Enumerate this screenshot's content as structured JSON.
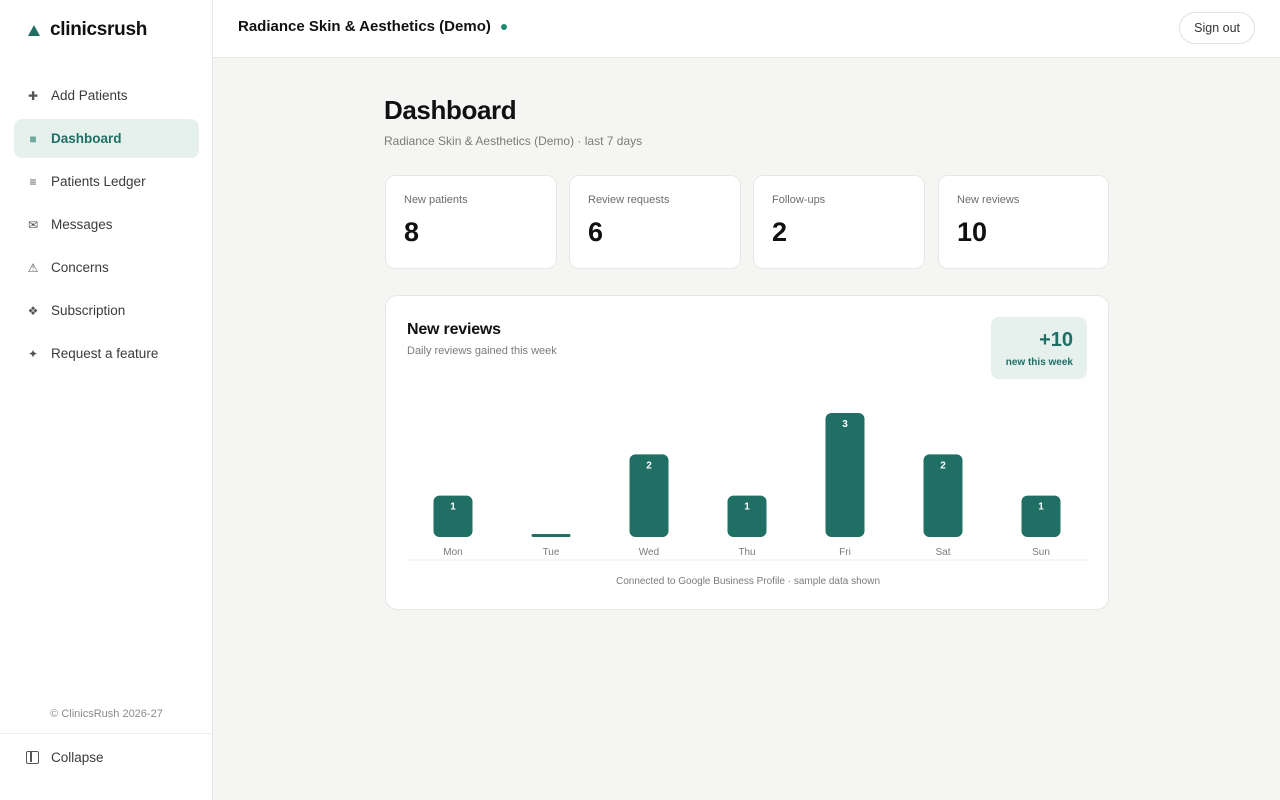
{
  "brand": {
    "name": "clinicsrush",
    "icon": "triangle-logo-icon"
  },
  "sidebar": {
    "items": [
      {
        "label": "Add Patients",
        "icon": "plus-icon",
        "glyph": "✚",
        "active": false
      },
      {
        "label": "Dashboard",
        "icon": "dashboard-square-icon",
        "glyph": "■",
        "active": true
      },
      {
        "label": "Patients Ledger",
        "icon": "list-icon",
        "glyph": "≡",
        "active": false
      },
      {
        "label": "Messages",
        "icon": "envelope-icon",
        "glyph": "✉",
        "active": false
      },
      {
        "label": "Concerns",
        "icon": "warning-icon",
        "glyph": "⚠",
        "active": false
      },
      {
        "label": "Subscription",
        "icon": "diamond-icon",
        "glyph": "❖",
        "active": false
      },
      {
        "label": "Request a feature",
        "icon": "sparkle-icon",
        "glyph": "✦",
        "active": false
      }
    ],
    "copyright": "© ClinicsRush 2026-27",
    "collapse_label": "Collapse"
  },
  "topbar": {
    "clinic_name": "Radiance Skin & Aesthetics (Demo)",
    "signout_label": "Sign out"
  },
  "page": {
    "title": "Dashboard",
    "subtitle": "Radiance Skin & Aesthetics (Demo) · last 7 days"
  },
  "stats": [
    {
      "label": "New patients",
      "value": "8"
    },
    {
      "label": "Review requests",
      "value": "6"
    },
    {
      "label": "Follow-ups",
      "value": "2"
    },
    {
      "label": "New reviews",
      "value": "10"
    }
  ],
  "reviews_card": {
    "title": "New reviews",
    "subtitle": "Daily reviews gained this week",
    "badge_value": "+10",
    "badge_label": "new this week",
    "footer": "Connected to Google Business Profile · sample data shown"
  },
  "chart_data": {
    "type": "bar",
    "categories": [
      "Mon",
      "Tue",
      "Wed",
      "Thu",
      "Fri",
      "Sat",
      "Sun"
    ],
    "values": [
      1,
      0,
      2,
      1,
      3,
      2,
      1
    ],
    "ylim": [
      0,
      3
    ],
    "grid": false,
    "color": "#1f6f64"
  },
  "colors": {
    "accent": "#1f6f64",
    "accent_light": "#e6f1ee"
  }
}
